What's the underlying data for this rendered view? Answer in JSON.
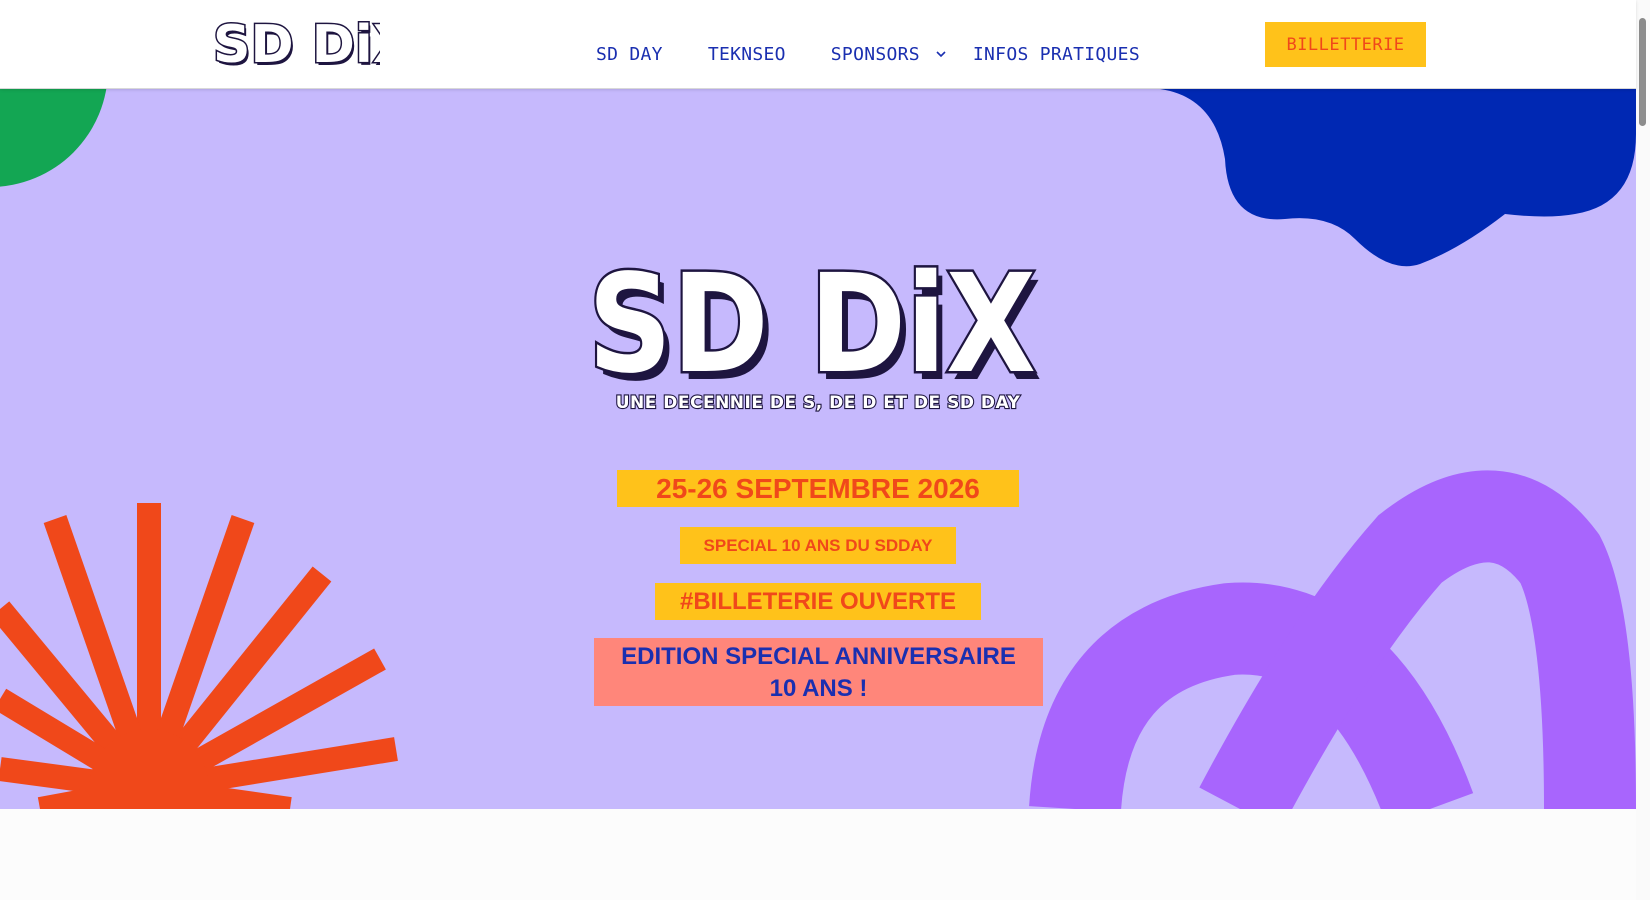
{
  "header": {
    "logo_text": "SD DiX",
    "nav": [
      {
        "label": "SD DAY"
      },
      {
        "label": "TEKNSEO"
      },
      {
        "label": "SPONSORS",
        "has_dropdown": true
      },
      {
        "label": "INFOS PRATIQUES"
      }
    ],
    "cta_label": "BILLETTERIE"
  },
  "hero": {
    "logo_text": "SD DiX",
    "tagline": "UNE DECENNIE DE S, DE D ET DE SD DAY",
    "date": "25-26 SEPTEMBRE 2026",
    "special": "SPECIAL 10 ANS DU SDDAY",
    "billetterie": "#BILLETERIE OUVERTE",
    "edition_line1": "EDITION SPECIAL ANNIVERSAIRE",
    "edition_line2": "10 ANS !"
  },
  "colors": {
    "hero_bg": "#c6b9fd",
    "accent_yellow": "#ffc21a",
    "accent_orange": "#f0481a",
    "nav_blue": "#1a2fb0",
    "salmon": "#ff867a",
    "green": "#13a653",
    "purple": "#a865fd",
    "dark": "#1e1540"
  }
}
